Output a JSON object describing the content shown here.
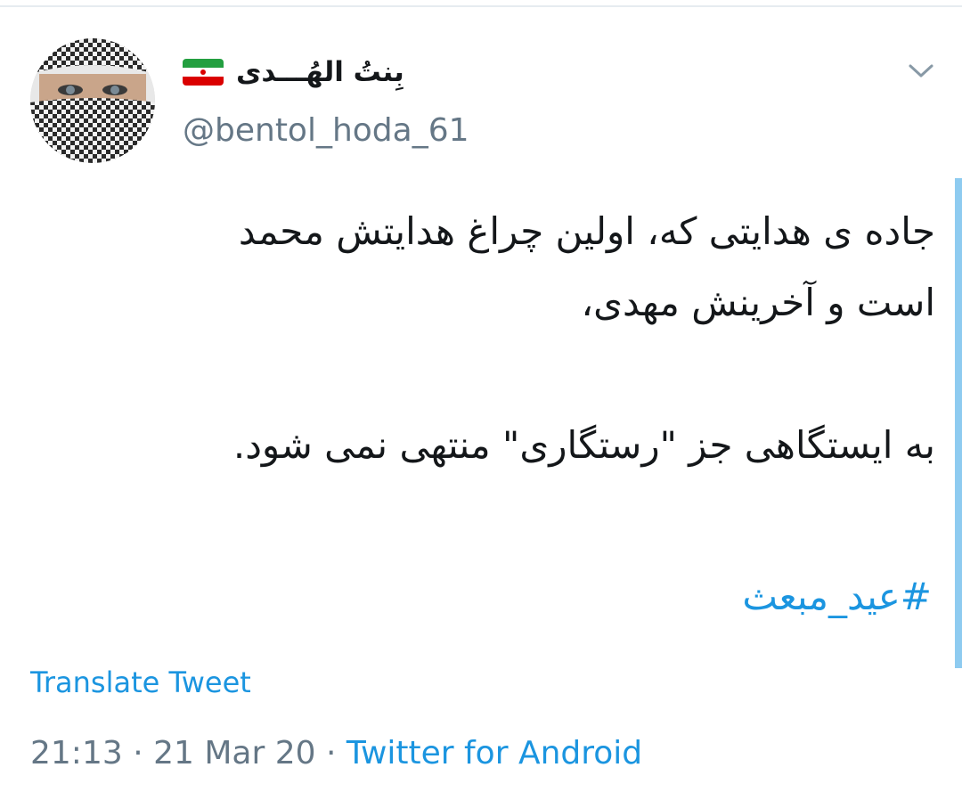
{
  "author": {
    "display_name": "بِنتُ الهُـــدی",
    "handle": "@bentol_hoda_61",
    "flag_icon": "iran-flag-icon",
    "avatar_icon": "avatar-image"
  },
  "tweet": {
    "lines": [
      "جاده ی هدایتی که، اولین چراغ هدایتش محمد",
      "است و آخرینش مهدی،",
      "",
      "به ایستگاهی جز \"رستگاری\" منتهی نمی شود.",
      "",
      ""
    ],
    "hashtag": "#عید_مبعث",
    "translate_label": "Translate Tweet"
  },
  "meta": {
    "time": "21:13",
    "separator": "·",
    "date": "21 Mar 20",
    "source": "Twitter for Android"
  },
  "menu": {
    "icon": "chevron-down-icon"
  },
  "colors": {
    "link": "#1b95e0",
    "secondary_text": "#657786",
    "primary_text": "#14171a",
    "scroll_indicator": "#8ecbf0"
  }
}
